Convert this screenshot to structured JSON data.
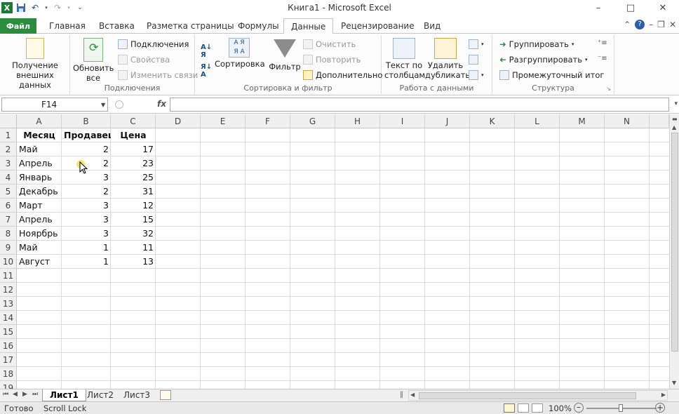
{
  "window": {
    "title": "Книга1  -  Microsoft Excel",
    "minimize": "–",
    "maximize": "□",
    "close": "✕"
  },
  "ribbon_tabs": {
    "file": "Файл",
    "tabs": [
      "Главная",
      "Вставка",
      "Разметка страницы",
      "Формулы",
      "Данные",
      "Рецензирование",
      "Вид"
    ],
    "active": "Данные"
  },
  "ribbon": {
    "get_external": "Получение внешних данных",
    "refresh_all": "Обновить все",
    "connections": "Подключения",
    "properties": "Свойства",
    "edit_links": "Изменить связи",
    "group_connections": "Подключения",
    "sort": "Сортировка",
    "filter": "Фильтр",
    "clear": "Очистить",
    "reapply": "Повторить",
    "advanced": "Дополнительно",
    "group_sort_filter": "Сортировка и фильтр",
    "text_to_columns": "Текст по столбцам",
    "remove_duplicates": "Удалить дубликаты",
    "group_data_tools": "Работа с данными",
    "group": "Группировать",
    "ungroup": "Разгруппировать",
    "subtotal": "Промежуточный итог",
    "group_outline": "Структура"
  },
  "formula_bar": {
    "name_box": "F14",
    "fx": "fx",
    "formula": ""
  },
  "columns": [
    "A",
    "B",
    "C",
    "D",
    "E",
    "F",
    "G",
    "H",
    "I",
    "J",
    "K",
    "L",
    "M",
    "N"
  ],
  "rows": [
    "1",
    "2",
    "3",
    "4",
    "5",
    "6",
    "7",
    "8",
    "9",
    "10",
    "11",
    "12",
    "13",
    "14",
    "15",
    "16",
    "17",
    "18",
    "19"
  ],
  "table": {
    "headers": [
      "Месяц",
      "Продавец",
      "Цена"
    ],
    "data": [
      [
        "Май",
        "2",
        "17"
      ],
      [
        "Апрель",
        "2",
        "23"
      ],
      [
        "Январь",
        "3",
        "25"
      ],
      [
        "Декабрь",
        "2",
        "31"
      ],
      [
        "Март",
        "3",
        "12"
      ],
      [
        "Апрель",
        "3",
        "15"
      ],
      [
        "Ноярбрь",
        "3",
        "32"
      ],
      [
        "Май",
        "1",
        "11"
      ],
      [
        "Август",
        "1",
        "13"
      ]
    ]
  },
  "sheets": {
    "tabs": [
      "Лист1",
      "Лист2",
      "Лист3"
    ],
    "active": "Лист1"
  },
  "status": {
    "ready": "Готово",
    "scroll_lock": "Scroll Lock",
    "zoom": "100%"
  }
}
